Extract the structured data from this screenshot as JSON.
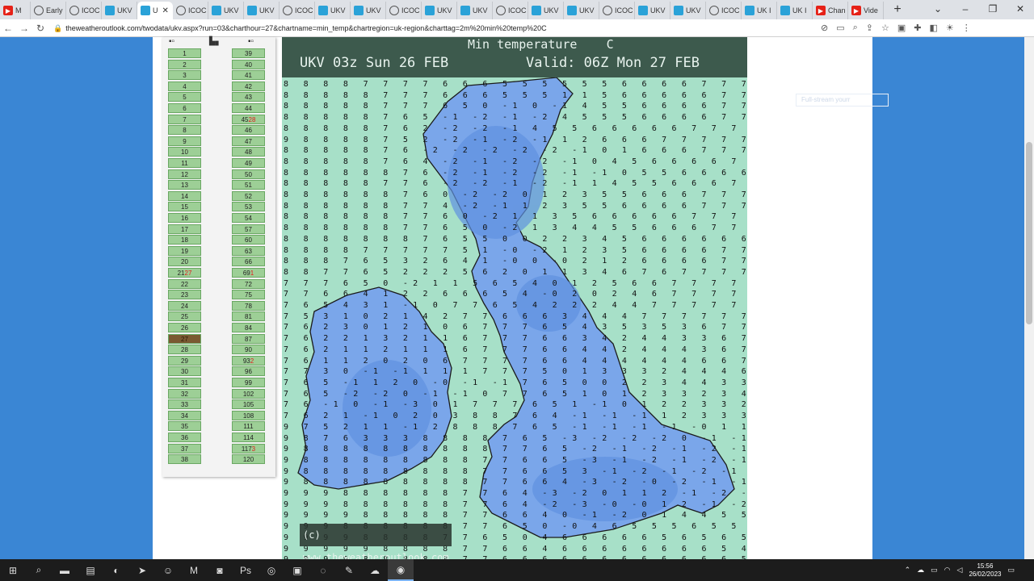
{
  "browser": {
    "tabs": [
      {
        "label": "M",
        "icon": "youtube-icon"
      },
      {
        "label": "Early",
        "icon": "globe-icon"
      },
      {
        "label": "ICOC",
        "icon": "globe-icon"
      },
      {
        "label": "UKV",
        "icon": "weatheroutlook-icon"
      },
      {
        "label": "U",
        "icon": "weatheroutlook-icon",
        "active": true
      },
      {
        "label": "ICOC",
        "icon": "globe-icon"
      },
      {
        "label": "UKV",
        "icon": "weatheroutlook-icon"
      },
      {
        "label": "UKV",
        "icon": "weatheroutlook-icon"
      },
      {
        "label": "ICOC",
        "icon": "globe-icon"
      },
      {
        "label": "UKV",
        "icon": "weatheroutlook-icon"
      },
      {
        "label": "UKV",
        "icon": "weatheroutlook-icon"
      },
      {
        "label": "ICOC",
        "icon": "globe-icon"
      },
      {
        "label": "UKV",
        "icon": "weatheroutlook-icon"
      },
      {
        "label": "UKV",
        "icon": "weatheroutlook-icon"
      },
      {
        "label": "ICOC",
        "icon": "globe-icon"
      },
      {
        "label": "UKV",
        "icon": "weatheroutlook-icon"
      },
      {
        "label": "UKV",
        "icon": "weatheroutlook-icon"
      },
      {
        "label": "ICOC",
        "icon": "globe-icon"
      },
      {
        "label": "UKV",
        "icon": "weatheroutlook-icon"
      },
      {
        "label": "UKV",
        "icon": "weatheroutlook-icon"
      },
      {
        "label": "ICOC",
        "icon": "globe-icon"
      },
      {
        "label": "UK I",
        "icon": "weatheroutlook-icon"
      },
      {
        "label": "UK I",
        "icon": "weatheroutlook-icon"
      },
      {
        "label": "Chan",
        "icon": "youtube-icon"
      },
      {
        "label": "Vide",
        "icon": "youtube-icon"
      }
    ],
    "url": "theweatheroutlook.com/twodata/ukv.aspx?run=03&charthour=27&chartname=min_temp&chartregion=uk-region&charttag=2m%20min%20temp%20C"
  },
  "sidebar": {
    "left_col": [
      "1",
      "2",
      "3",
      "4",
      "5",
      "6",
      "7",
      "8",
      "9",
      "10",
      "11",
      "12",
      "13",
      "14",
      "15",
      "16",
      "17",
      "18",
      "19",
      "20",
      "21",
      "22",
      "23",
      "24",
      "25",
      "26",
      "27",
      "28",
      "29",
      "30",
      "31",
      "32",
      "33",
      "34",
      "35",
      "36",
      "37",
      "38"
    ],
    "left_badges": {
      "20": "27"
    },
    "selected_index": 26,
    "right_col": [
      "39",
      "40",
      "41",
      "42",
      "43",
      "44",
      "45",
      "46",
      "47",
      "48",
      "49",
      "50",
      "51",
      "52",
      "53",
      "54",
      "57",
      "60",
      "63",
      "66",
      "69",
      "72",
      "75",
      "78",
      "81",
      "84",
      "87",
      "90",
      "93",
      "96",
      "99",
      "102",
      "105",
      "108",
      "111",
      "114",
      "117",
      "120"
    ],
    "right_badges": {
      "6": "28",
      "20": "1",
      "28": "2",
      "36": "3"
    }
  },
  "chart": {
    "title": "Min temperature    C",
    "run_label": "UKV 03z Sun 26 FEB",
    "valid_label": "Valid: 06Z Mon 27 FEB",
    "copyright": "(c) www.theweatheroutlook.com",
    "colors": {
      "sea": "#a7e0c8",
      "land_cold": "#6e9ee6",
      "header": "#3d5a4d"
    }
  },
  "search_hint": "Full-stream yourr",
  "taskbar": {
    "time": "15:56",
    "date": "26/02/2023"
  }
}
